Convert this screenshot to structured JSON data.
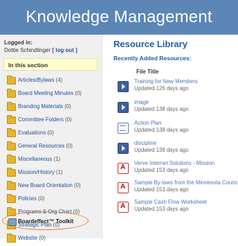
{
  "header": {
    "title": "Knowledge Management"
  },
  "user": {
    "logged_in_label": "Logged in:",
    "name": "Dottie Schindlinger",
    "logout_label": "[ log out ]"
  },
  "sidebar": {
    "section_title": "In this section",
    "items": [
      {
        "label": "Articles/Bylaws",
        "count": "(4)"
      },
      {
        "label": "Board Meeting Minutes",
        "count": "(0)"
      },
      {
        "label": "Branding Materials",
        "count": "(0)"
      },
      {
        "label": "Committee Folders",
        "count": "(0)"
      },
      {
        "label": "Evaluations",
        "count": "(0)"
      },
      {
        "label": "General Resources",
        "count": "(0)"
      },
      {
        "label": "Miscellaneous",
        "count": "(1)"
      },
      {
        "label": "Mission/History",
        "count": "(1)"
      },
      {
        "label": "New Board Orientation",
        "count": "(0)"
      },
      {
        "label": "Policies",
        "count": "(0)"
      },
      {
        "label": "Programs & Org Chart",
        "count": "(0)"
      },
      {
        "label": "Strategic Plan",
        "count": "(0)"
      },
      {
        "label": "Website",
        "count": "(0)"
      }
    ],
    "toolkit_label": "Boardeffect™ Toolkit"
  },
  "main": {
    "title": "Resource Library",
    "subtitle": "Recently Added Resources:",
    "column_header": "File Title",
    "resources": [
      {
        "title": "Training for New Members",
        "updated": "Updated 126 days ago",
        "icon": "video-icon"
      },
      {
        "title": "image",
        "updated": "Updated 138 days ago",
        "icon": "video-icon"
      },
      {
        "title": "Action Plan",
        "updated": "Updated 138 days ago",
        "icon": "document-icon"
      },
      {
        "title": "discipline",
        "updated": "Updated 138 days ago",
        "icon": "video-icon"
      },
      {
        "title": "Verve Internet Solutions - Mission",
        "updated": "Updated 153 days ago",
        "icon": "pdf-icon"
      },
      {
        "title": "Sample By-laws from the Minnesota Counc",
        "updated": "Updated 153 days ago",
        "icon": "pdf-icon"
      },
      {
        "title": "Sample Cash Flow Worksheet",
        "updated": "Updated 153 days ago",
        "icon": "pdf-icon"
      }
    ]
  },
  "colors": {
    "banner": "#5b86b6",
    "link": "#1f4f9a",
    "highlight": "#f07b2a",
    "section_bg": "#ffffd0"
  }
}
